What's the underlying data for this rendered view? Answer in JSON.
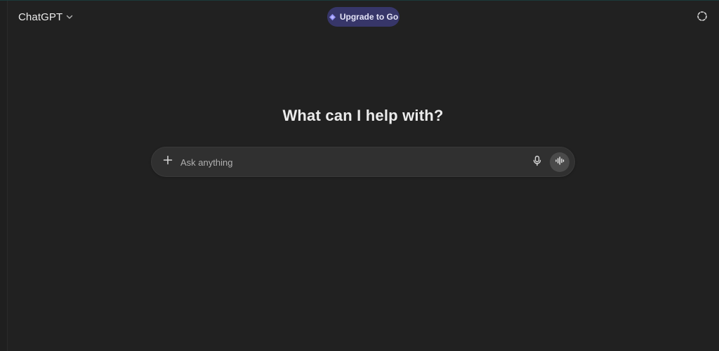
{
  "header": {
    "model_name": "ChatGPT",
    "upgrade_label": "Upgrade to Go"
  },
  "main": {
    "title": "What can I help with?"
  },
  "composer": {
    "placeholder": "Ask anything"
  },
  "icons": {
    "model_dropdown": "chevron-down-icon",
    "upgrade": "diamond-icon",
    "temporary_chat": "dashed-circle-icon",
    "attach": "plus-icon",
    "dictate": "microphone-icon",
    "voice_mode": "voice-waveform-icon"
  },
  "colors": {
    "background": "#212121",
    "composer": "#303030",
    "upgrade_pill": "#373669",
    "upgrade_accent": "#8f8cf2",
    "text": "#ececec"
  }
}
